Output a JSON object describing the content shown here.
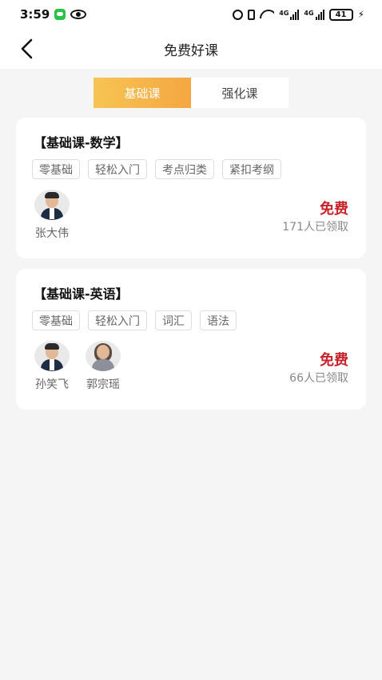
{
  "status_bar": {
    "time": "3:59",
    "battery": "41",
    "signal_tag_1": "4G",
    "signal_tag_2": "4G"
  },
  "header": {
    "title": "免费好课"
  },
  "tabs": [
    {
      "label": "基础课",
      "active": true
    },
    {
      "label": "强化课",
      "active": false
    }
  ],
  "courses": [
    {
      "title": "【基础课-数学】",
      "tags": [
        "零基础",
        "轻松入门",
        "考点归类",
        "紧扣考纲"
      ],
      "teachers": [
        {
          "name": "张大伟"
        }
      ],
      "price": "免费",
      "claimed": "171人已领取"
    },
    {
      "title": "【基础课-英语】",
      "tags": [
        "零基础",
        "轻松入门",
        "词汇",
        "语法"
      ],
      "teachers": [
        {
          "name": "孙笑飞"
        },
        {
          "name": "郭宗瑶"
        }
      ],
      "price": "免费",
      "claimed": "66人已领取"
    }
  ],
  "colors": {
    "accent_start": "#f6c453",
    "accent_end": "#f5a742",
    "price": "#c8222a",
    "background": "#f5f5f5"
  }
}
